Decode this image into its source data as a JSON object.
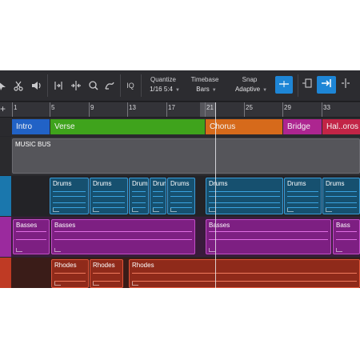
{
  "toolbar": {
    "icons": [
      "cursor-icon",
      "scissors-icon",
      "speaker-icon",
      "bend-marker-icon",
      "split-icon",
      "listen-icon",
      "paint-icon",
      "iq-icon",
      "snap-cursor-icon",
      "snap-grid-icon",
      "snap-arrow-icon",
      "nudge-icon"
    ],
    "iq_label": "IQ",
    "quantize": {
      "label": "Quantize",
      "value": "1/16 5:4"
    },
    "timebase": {
      "label": "Timebase",
      "value": "Bars"
    },
    "snap": {
      "label": "Snap",
      "value": "Adaptive"
    },
    "accent_color": "#1e86d6"
  },
  "ruler": {
    "add_icon": "plus-icon",
    "ticks": [
      "1",
      "5",
      "9",
      "13",
      "17",
      "21",
      "25",
      "29",
      "33"
    ]
  },
  "arranger": {
    "sections": [
      {
        "label": "Intro",
        "color": "#2162c6"
      },
      {
        "label": "Verse",
        "color": "#3fa31c"
      },
      {
        "label": "Chorus",
        "color": "#d66a1b"
      },
      {
        "label": "Bridge",
        "color": "#ad2590"
      },
      {
        "label": "Hal..oros",
        "color": "#c22446"
      }
    ]
  },
  "tracks": {
    "music_bus": {
      "label": "MUSIC BUS",
      "color": "#5a5a5f"
    },
    "drums": {
      "color": "#1a77ad",
      "clips": [
        "Drums",
        "Drums",
        "Drums",
        "Drums",
        "Drums",
        "Drums",
        "Drums",
        "Drums"
      ]
    },
    "basses": {
      "color": "#9b2a9e",
      "clips": [
        "Basses",
        "Basses",
        "Basses",
        "Bass"
      ]
    },
    "rhodes": {
      "color": "#bf3a24",
      "clips": [
        "Rhodes",
        "Rhodes",
        "Rhodes"
      ]
    }
  }
}
